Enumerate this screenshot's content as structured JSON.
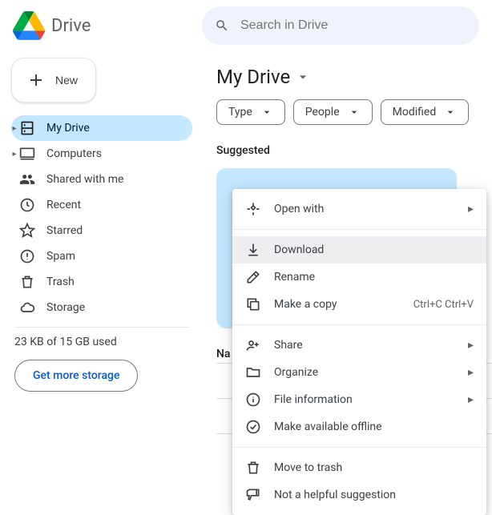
{
  "header": {
    "product_name": "Drive",
    "search_placeholder": "Search in Drive"
  },
  "sidebar": {
    "new_label": "New",
    "items": [
      {
        "label": "My Drive"
      },
      {
        "label": "Computers"
      },
      {
        "label": "Shared with me"
      },
      {
        "label": "Recent"
      },
      {
        "label": "Starred"
      },
      {
        "label": "Spam"
      },
      {
        "label": "Trash"
      },
      {
        "label": "Storage"
      }
    ],
    "storage_used": "23 KB of 15 GB used",
    "get_more": "Get more storage"
  },
  "content": {
    "breadcrumb": "My Drive",
    "chips": [
      {
        "label": "Type"
      },
      {
        "label": "People"
      },
      {
        "label": "Modified"
      }
    ],
    "suggested_label": "Suggested",
    "col_name": "Na"
  },
  "context_menu": {
    "open_with": "Open with",
    "download": "Download",
    "rename": "Rename",
    "make_copy": "Make a copy",
    "make_copy_hint": "Ctrl+C Ctrl+V",
    "share": "Share",
    "organize": "Organize",
    "file_info": "File information",
    "offline": "Make available offline",
    "trash": "Move to trash",
    "not_helpful": "Not a helpful suggestion"
  }
}
